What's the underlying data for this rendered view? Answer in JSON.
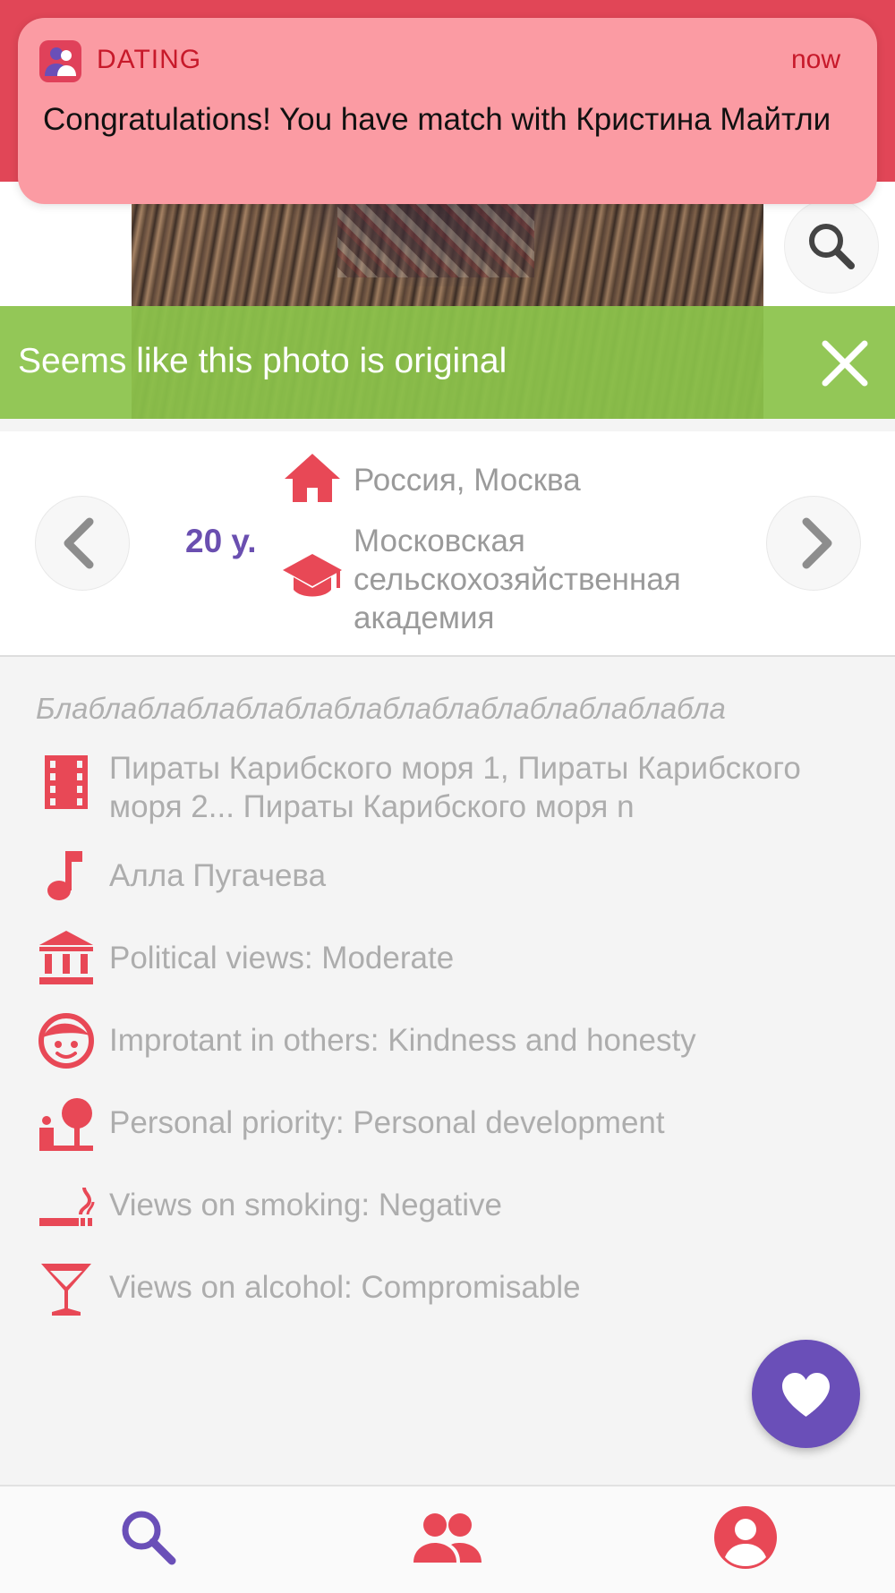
{
  "notification": {
    "app_name": "DATING",
    "time": "now",
    "message": "Congratulations! You have match with Кристина Майтли"
  },
  "verification": {
    "text": "Seems like this photo is original"
  },
  "profile": {
    "age": "20 y.",
    "location": "Россия, Москва",
    "education_lines": [
      "Московская",
      "сельскохозяйственная",
      "академия"
    ],
    "bio": "Блаблаблаблаблаблаблаблаблаблаблаблаблабла"
  },
  "details": [
    {
      "icon": "film-icon",
      "lines": [
        "Пираты Карибского моря 1, Пираты Карибского",
        "моря 2... Пираты Карибского моря n"
      ]
    },
    {
      "icon": "music-note-icon",
      "lines": [
        "Алла Пугачева"
      ]
    },
    {
      "icon": "government-building-icon",
      "lines": [
        "Political views: Moderate"
      ]
    },
    {
      "icon": "face-icon",
      "lines": [
        "Improtant in others: Kindness and honesty"
      ]
    },
    {
      "icon": "personal-priority-icon",
      "lines": [
        "Personal priority: Personal development"
      ]
    },
    {
      "icon": "smoking-icon",
      "lines": [
        "Views on smoking: Negative"
      ]
    },
    {
      "icon": "cocktail-icon",
      "lines": [
        "Views on alcohol: Compromisable"
      ]
    }
  ],
  "bottom_nav": [
    {
      "icon": "search-icon",
      "active": true
    },
    {
      "icon": "people-icon",
      "active": false
    },
    {
      "icon": "account-icon",
      "active": false
    }
  ],
  "colors": {
    "accent_red": "#e84856",
    "accent_purple": "#6a4fb8",
    "verify_green": "#8bc34a",
    "notification_bg": "#fb9ba3"
  }
}
